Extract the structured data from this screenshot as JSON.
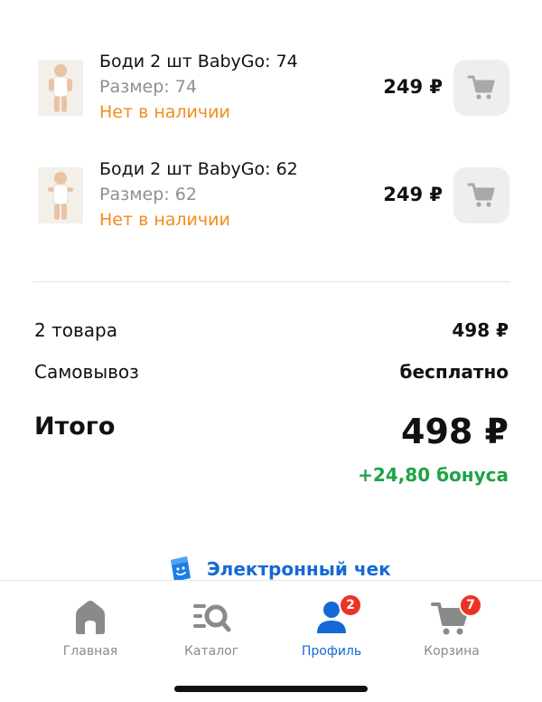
{
  "products": [
    {
      "title": "Боди 2 шт BabyGo: 74",
      "size": "Размер: 74",
      "stock": "Нет в наличии",
      "price": "249 ₽"
    },
    {
      "title": "Боди 2 шт BabyGo: 62",
      "size": "Размер: 62",
      "stock": "Нет в наличии",
      "price": "249 ₽"
    }
  ],
  "summary": {
    "items_label": "2 товара",
    "items_value": "498 ₽",
    "delivery_label": "Самовывоз",
    "delivery_value": "бесплатно",
    "total_label": "Итого",
    "total_value": "498 ₽",
    "bonus": "+24,80 бонуса"
  },
  "receipt": {
    "label": "Электронный чек"
  },
  "tabbar": {
    "tabs": [
      {
        "label": "Главная",
        "icon": "home-icon",
        "active": false
      },
      {
        "label": "Каталог",
        "icon": "catalog-search-icon",
        "active": false
      },
      {
        "label": "Профиль",
        "icon": "profile-icon",
        "active": true,
        "badge": "2"
      },
      {
        "label": "Корзина",
        "icon": "cart-icon",
        "active": false,
        "badge": "7"
      }
    ]
  },
  "colors": {
    "accent_blue": "#1569d6",
    "out_of_stock_orange": "#f28c1e",
    "bonus_green": "#1fa345",
    "badge_red": "#ee3124",
    "icon_gray": "#8a8a8a"
  }
}
